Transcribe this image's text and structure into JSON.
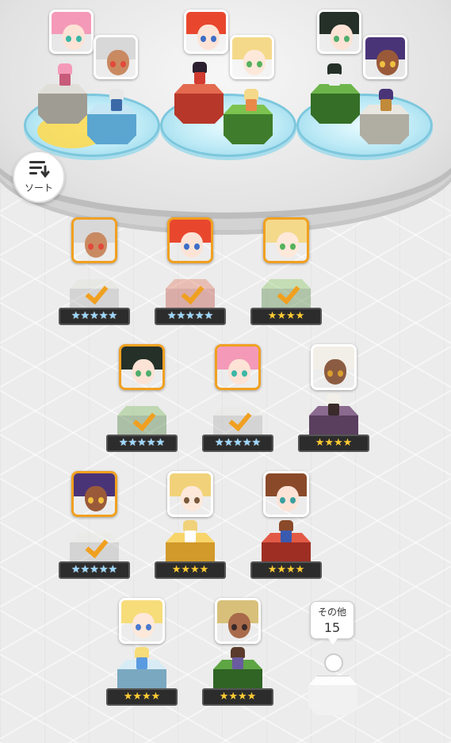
{
  "sort_button": {
    "label": "ソート",
    "icon": "sort-icon"
  },
  "others": {
    "label": "その他",
    "count": "15"
  },
  "colors": {
    "selected": "#f0a020",
    "star": "#ffcc33",
    "pad": "#8fd3e8"
  },
  "party": [
    {
      "name": "team-1",
      "members": [
        {
          "id": "pink-girl",
          "element": "wind",
          "icon": "sparkle-icon"
        },
        {
          "id": "silver-warrior",
          "element": "water",
          "icon": "circle-icon"
        }
      ]
    },
    {
      "name": "team-2",
      "members": [
        {
          "id": "red-witch",
          "element": "fire",
          "icon": "fire-icon"
        },
        {
          "id": "blonde-girl",
          "element": "wind",
          "icon": "leaf-icon"
        }
      ]
    },
    {
      "name": "team-3",
      "members": [
        {
          "id": "black-maid",
          "element": "wind",
          "icon": "leaf-icon"
        },
        {
          "id": "dark-elf",
          "element": "wind",
          "icon": "sparkle-icon"
        }
      ]
    }
  ],
  "roster": [
    {
      "id": "silver-warrior",
      "stars": "★★★★★",
      "rank": 5,
      "selected": true
    },
    {
      "id": "red-witch",
      "stars": "★★★★★",
      "rank": 5,
      "selected": true
    },
    {
      "id": "blonde-girl",
      "stars": "★★★★",
      "rank": 4,
      "selected": true
    },
    {
      "id": "black-maid",
      "stars": "★★★★★",
      "rank": 5,
      "selected": true
    },
    {
      "id": "pink-girl",
      "stars": "★★★★★",
      "rank": 5,
      "selected": true
    },
    {
      "id": "white-hair-girl",
      "stars": "★★★★",
      "rank": 4,
      "selected": false
    },
    {
      "id": "dark-elf",
      "stars": "★★★★★",
      "rank": 5,
      "selected": true
    },
    {
      "id": "glasses-girl",
      "stars": "★★★★",
      "rank": 4,
      "selected": false
    },
    {
      "id": "brown-boy",
      "stars": "★★★★",
      "rank": 4,
      "selected": false
    },
    {
      "id": "alice-girl",
      "stars": "★★★★",
      "rank": 4,
      "selected": false
    },
    {
      "id": "brown-ranger",
      "stars": "★★★★",
      "rank": 4,
      "selected": false
    }
  ]
}
